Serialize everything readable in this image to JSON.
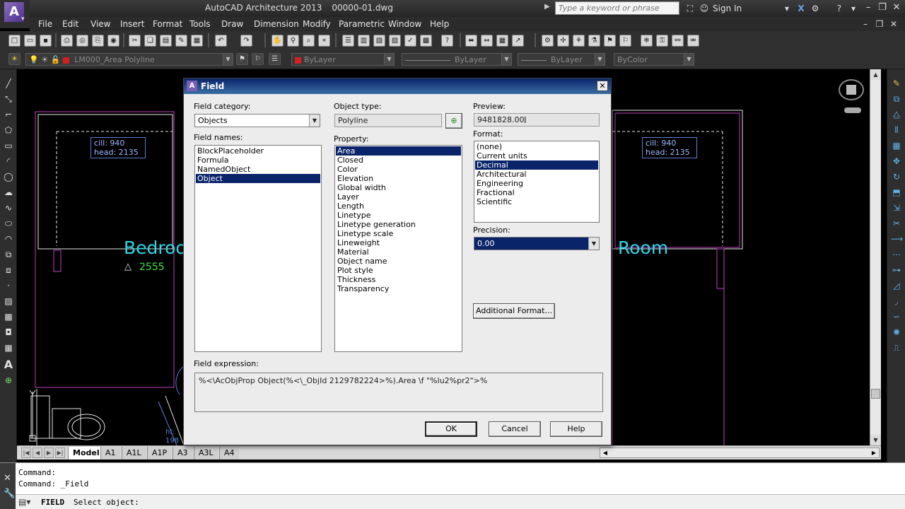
{
  "app": {
    "title": "AutoCAD Architecture 2013",
    "document": "00000-01.dwg",
    "logo_letter": "A",
    "search_placeholder": "Type a keyword or phrase",
    "sign_in": "Sign In"
  },
  "menu": [
    "File",
    "Edit",
    "View",
    "Insert",
    "Format",
    "Tools",
    "Draw",
    "Dimension",
    "Modify",
    "Parametric",
    "Window",
    "Help"
  ],
  "layer_toolbar": {
    "layer_name": "LM000_Area Polyline",
    "color": "ByLayer",
    "color_swatch": "#d42020",
    "linetype": "ByLayer",
    "lineweight": "ByLayer",
    "plotstyle": "ByColor"
  },
  "drawing": {
    "left_tag": {
      "line1": "cill:    940",
      "line2": "head: 2135"
    },
    "right_tag": {
      "line1": "cill:    940",
      "line2": "head: 2135"
    },
    "room_left": "Bedroo",
    "room_right": "Room",
    "room_left_value": "2555",
    "triangle_glyph": "△",
    "partial_tag": {
      "line1": "ht:",
      "line2": "198"
    },
    "colors": {
      "room_text": "#2ed8e8",
      "value_text": "#3ee83e",
      "walls": "#c040c0",
      "white_lines": "#e6e6e6"
    }
  },
  "layout_tabs": [
    "Model",
    "A1",
    "A1L",
    "A1P",
    "A3",
    "A3L",
    "A4"
  ],
  "command_lines": [
    "Command:",
    "Command: _Field"
  ],
  "command_prompt": {
    "command": "FIELD",
    "text": "Select object:"
  },
  "dialog": {
    "title": "Field",
    "close": "✕",
    "field_category_label": "Field category:",
    "field_category_value": "Objects",
    "field_names_label": "Field names:",
    "field_names": [
      "BlockPlaceholder",
      "Formula",
      "NamedObject",
      "Object"
    ],
    "field_names_selected": 3,
    "object_type_label": "Object type:",
    "object_type_value": "Polyline",
    "property_label": "Property:",
    "properties": [
      "Area",
      "Closed",
      "Color",
      "Elevation",
      "Global width",
      "Layer",
      "Length",
      "Linetype",
      "Linetype generation",
      "Linetype scale",
      "Lineweight",
      "Material",
      "Object name",
      "Plot style",
      "Thickness",
      "Transparency"
    ],
    "properties_selected": 0,
    "preview_label": "Preview:",
    "preview_value": "9481828.00",
    "format_label": "Format:",
    "formats": [
      "(none)",
      "Current units",
      "Decimal",
      "Architectural",
      "Engineering",
      "Fractional",
      "Scientific"
    ],
    "formats_selected": 2,
    "precision_label": "Precision:",
    "precision_value": "0.00",
    "additional_format": "Additional Format...",
    "field_expression_label": "Field expression:",
    "field_expression": "%<\\AcObjProp Object(%<\\_ObjId 2129782224>%).Area \\f \"%lu2%pr2\">%",
    "ok": "OK",
    "cancel": "Cancel",
    "help": "Help"
  }
}
